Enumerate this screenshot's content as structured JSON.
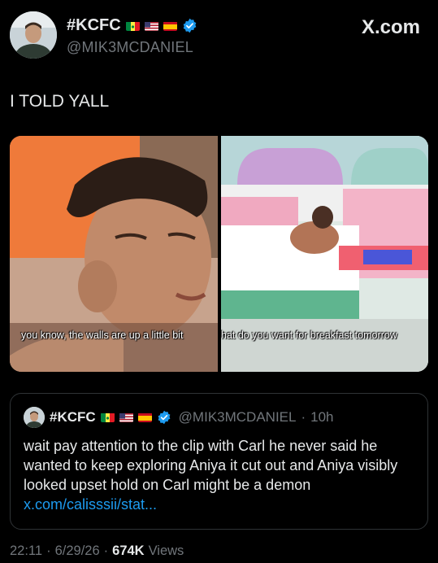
{
  "header": {
    "display_name": "#KCFC",
    "handle": "@MIK3MCDANIEL",
    "site": "X.com",
    "flags": [
      "senegal-flag-icon",
      "usa-flag-icon",
      "spain-flag-icon"
    ],
    "verified_icon": "verified-badge-icon"
  },
  "tweet": {
    "text": "I TOLD YALL",
    "media": {
      "left_caption": "you know, the walls are up a little bit",
      "right_caption": "hat do you want for breakfast tomorrow"
    }
  },
  "quoted_tweet": {
    "display_name": "#KCFC",
    "handle": "@MIK3MCDANIEL",
    "separator": "·",
    "time": "10h",
    "text": "wait pay attention to the clip with Carl he never said he wanted to keep exploring Aniya it cut out and Aniya visibly looked upset hold on Carl might be a demon ",
    "link": "x.com/calisssii/stat..."
  },
  "meta": {
    "time": "22:11",
    "sep1": "·",
    "date": "6/29/26",
    "sep2": "·",
    "views_count": "674K",
    "views_label": "Views"
  },
  "colors": {
    "background": "#000000",
    "text": "#e7e9ea",
    "secondary": "#71767b",
    "link": "#1d9bf0",
    "verified": "#1d9bf0",
    "border": "#2f3336"
  }
}
